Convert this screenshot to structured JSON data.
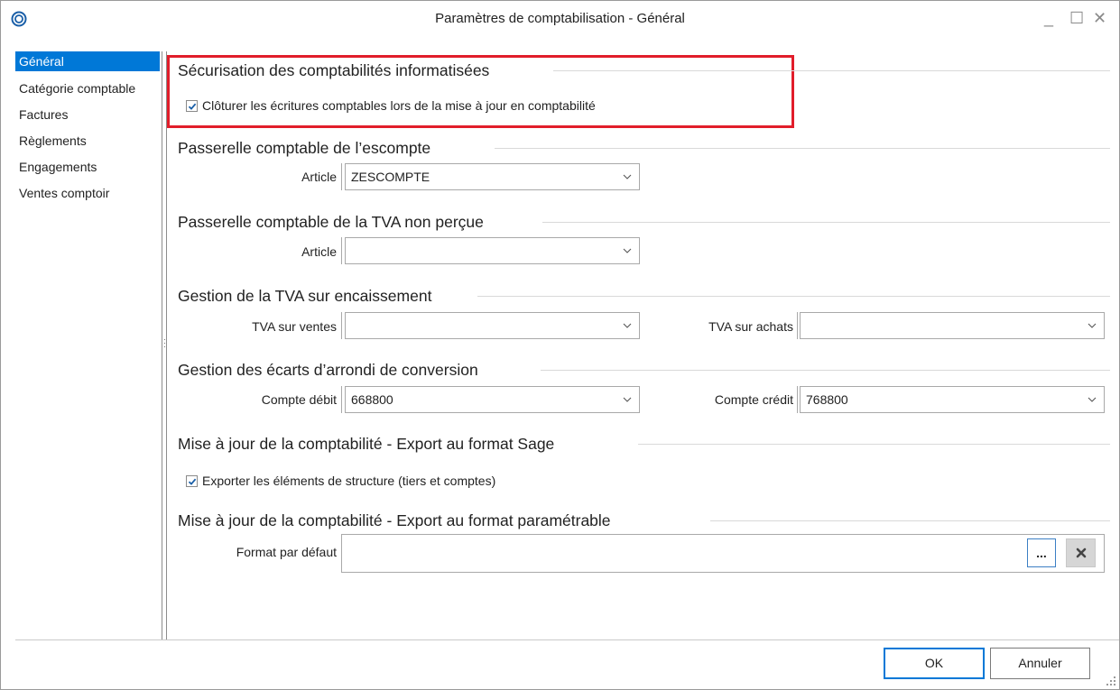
{
  "window": {
    "title": "Paramètres de comptabilisation - Général",
    "controls": {
      "minimize": "_",
      "maximize": "☐",
      "close": "✕"
    }
  },
  "sidebar": {
    "items": [
      {
        "label": "Général",
        "active": true
      },
      {
        "label": "Catégorie comptable",
        "active": false
      },
      {
        "label": "Factures",
        "active": false
      },
      {
        "label": "Règlements",
        "active": false
      },
      {
        "label": "Engagements",
        "active": false
      },
      {
        "label": "Ventes comptoir",
        "active": false
      }
    ]
  },
  "sections": {
    "securisation": {
      "title": "Sécurisation des comptabilités informatisées",
      "checkbox_label": "Clôturer les écritures comptables lors de la mise à jour en comptabilité",
      "checked": true
    },
    "escompte": {
      "title": "Passerelle comptable de l’escompte",
      "article_label": "Article",
      "article_value": "ZESCOMPTE"
    },
    "tva_non_percue": {
      "title": "Passerelle comptable de la TVA non perçue",
      "article_label": "Article",
      "article_value": ""
    },
    "tva_encaissement": {
      "title": "Gestion de la TVA sur encaissement",
      "ventes_label": "TVA sur ventes",
      "ventes_value": "",
      "achats_label": "TVA sur achats",
      "achats_value": ""
    },
    "ecarts": {
      "title": "Gestion des écarts d’arrondi de conversion",
      "debit_label": "Compte débit",
      "debit_value": "668800",
      "credit_label": "Compte crédit",
      "credit_value": "768800"
    },
    "export_sage": {
      "title": "Mise à jour de la comptabilité - Export au format Sage",
      "checkbox_label": "Exporter les éléments de structure (tiers et comptes)",
      "checked": true
    },
    "export_param": {
      "title": "Mise à jour de la comptabilité - Export au format paramétrable",
      "format_label": "Format par défaut",
      "format_value": "",
      "browse_label": "...",
      "clear_icon": "x-icon"
    }
  },
  "footer": {
    "ok_label": "OK",
    "cancel_label": "Annuler"
  },
  "colors": {
    "accent": "#0078d7",
    "highlight": "#e11d2a"
  }
}
